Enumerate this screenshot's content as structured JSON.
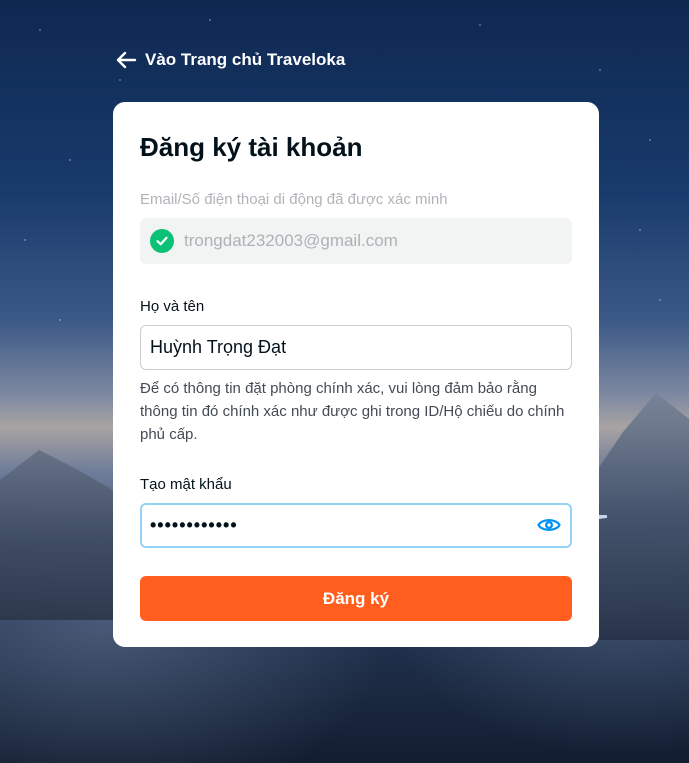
{
  "back_link": {
    "label": "Vào Trang chủ Traveloka"
  },
  "card": {
    "title": "Đăng ký tài khoản",
    "verified_label": "Email/Số điện thoại di động đã được xác minh",
    "verified_email": "trongdat232003@gmail.com",
    "name_label": "Họ và tên",
    "name_value": "Huỳnh Trọng Đạt",
    "name_hint": "Để có thông tin đặt phòng chính xác, vui lòng đảm bảo rằng thông tin đó chính xác như được ghi trong ID/Hộ chiếu do chính phủ cấp.",
    "password_label": "Tạo mật khẩu",
    "password_masked": "••••••••••••",
    "submit_label": "Đăng ký"
  },
  "colors": {
    "accent": "#ff5e1f",
    "verified": "#0bc175",
    "focus_border": "#94d3f5",
    "eye_icon": "#0194f3"
  },
  "icons": {
    "back": "arrow-left-icon",
    "verified": "check-circle-icon",
    "toggle_password": "eye-icon"
  }
}
